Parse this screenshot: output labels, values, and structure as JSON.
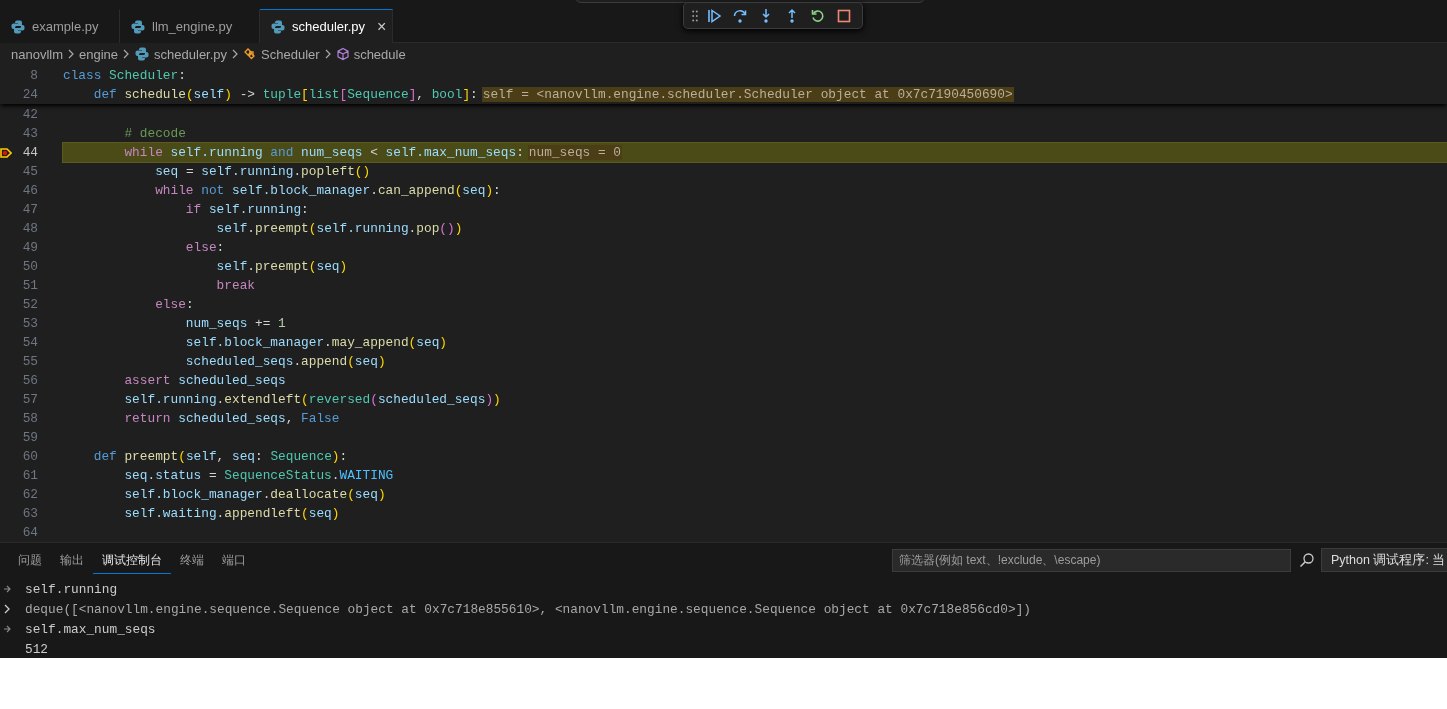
{
  "tabs": [
    {
      "label": "example.py",
      "selected": false
    },
    {
      "label": "llm_engine.py",
      "selected": false
    },
    {
      "label": "scheduler.py",
      "selected": true,
      "close": "×"
    }
  ],
  "debug_toolbar": [
    {
      "kind": "continue"
    },
    {
      "kind": "step-over"
    },
    {
      "kind": "step-into"
    },
    {
      "kind": "step-out"
    },
    {
      "kind": "restart"
    },
    {
      "kind": "stop"
    }
  ],
  "breadcrumbs": [
    {
      "label": "nanovllm",
      "kind": "folder"
    },
    {
      "label": "engine",
      "kind": "folder"
    },
    {
      "label": "scheduler.py",
      "kind": "file"
    },
    {
      "label": "Scheduler",
      "kind": "class"
    },
    {
      "label": "schedule",
      "kind": "method"
    }
  ],
  "sticky_lines": [
    {
      "number": "8",
      "tokens": [
        {
          "kind": "def",
          "text": "class "
        },
        {
          "kind": "cls",
          "text": "Scheduler"
        },
        {
          "kind": "p",
          "text": ":"
        }
      ]
    },
    {
      "number": "24",
      "tokens": [
        {
          "kind": "def",
          "text": "    def "
        },
        {
          "kind": "fn",
          "text": "schedule"
        },
        {
          "kind": "b1",
          "text": "("
        },
        {
          "kind": "var",
          "text": "self"
        },
        {
          "kind": "b1",
          "text": ")"
        },
        {
          "kind": "p",
          "text": " -> "
        },
        {
          "kind": "cls",
          "text": "tuple"
        },
        {
          "kind": "b1",
          "text": "["
        },
        {
          "kind": "cls",
          "text": "list"
        },
        {
          "kind": "b2",
          "text": "["
        },
        {
          "kind": "cls",
          "text": "Sequence"
        },
        {
          "kind": "b2",
          "text": "]"
        },
        {
          "kind": "p",
          "text": ", "
        },
        {
          "kind": "cls",
          "text": "bool"
        },
        {
          "kind": "b1",
          "text": "]"
        },
        {
          "kind": "p",
          "text": ":"
        }
      ],
      "inline_value": "self = <nanovllm.engine.scheduler.Scheduler object at 0x7c7190450690>"
    }
  ],
  "lines": [
    {
      "number": "42",
      "current": false
    },
    {
      "number": "43",
      "current": false,
      "tokens": [
        {
          "kind": "cmt",
          "text": "        # decode"
        }
      ]
    },
    {
      "number": "44",
      "current": true,
      "tokens": [
        {
          "kind": "kw",
          "text": "        while "
        },
        {
          "kind": "var",
          "text": "self.running "
        },
        {
          "kind": "def",
          "text": "and "
        },
        {
          "kind": "var",
          "text": "num_seqs"
        },
        {
          "kind": "p",
          "text": " < "
        },
        {
          "kind": "var",
          "text": "self.max_num_seqs"
        },
        {
          "kind": "p",
          "text": ":"
        }
      ],
      "inline_value": "num_seqs = 0"
    },
    {
      "number": "45",
      "current": false,
      "tokens": [
        {
          "kind": "var",
          "text": "            seq"
        },
        {
          "kind": "p",
          "text": " = "
        },
        {
          "kind": "var",
          "text": "self.running"
        },
        {
          "kind": "p",
          "text": "."
        },
        {
          "kind": "fn",
          "text": "popleft"
        },
        {
          "kind": "b1",
          "text": "()"
        }
      ]
    },
    {
      "number": "46",
      "current": false,
      "tokens": [
        {
          "kind": "kw",
          "text": "            while "
        },
        {
          "kind": "def",
          "text": "not "
        },
        {
          "kind": "var",
          "text": "self.block_manager"
        },
        {
          "kind": "p",
          "text": "."
        },
        {
          "kind": "fn",
          "text": "can_append"
        },
        {
          "kind": "b1",
          "text": "("
        },
        {
          "kind": "var",
          "text": "seq"
        },
        {
          "kind": "b1",
          "text": ")"
        },
        {
          "kind": "p",
          "text": ":"
        }
      ]
    },
    {
      "number": "47",
      "current": false,
      "tokens": [
        {
          "kind": "kw",
          "text": "                if "
        },
        {
          "kind": "var",
          "text": "self.running"
        },
        {
          "kind": "p",
          "text": ":"
        }
      ]
    },
    {
      "number": "48",
      "current": false,
      "tokens": [
        {
          "kind": "var",
          "text": "                    self"
        },
        {
          "kind": "p",
          "text": "."
        },
        {
          "kind": "fn",
          "text": "preempt"
        },
        {
          "kind": "b1",
          "text": "("
        },
        {
          "kind": "var",
          "text": "self.running"
        },
        {
          "kind": "p",
          "text": "."
        },
        {
          "kind": "fn",
          "text": "pop"
        },
        {
          "kind": "b2",
          "text": "()"
        },
        {
          "kind": "b1",
          "text": ")"
        }
      ]
    },
    {
      "number": "49",
      "current": false,
      "tokens": [
        {
          "kind": "kw",
          "text": "                else"
        },
        {
          "kind": "p",
          "text": ":"
        }
      ]
    },
    {
      "number": "50",
      "current": false,
      "tokens": [
        {
          "kind": "var",
          "text": "                    self"
        },
        {
          "kind": "p",
          "text": "."
        },
        {
          "kind": "fn",
          "text": "preempt"
        },
        {
          "kind": "b1",
          "text": "("
        },
        {
          "kind": "var",
          "text": "seq"
        },
        {
          "kind": "b1",
          "text": ")"
        }
      ]
    },
    {
      "number": "51",
      "current": false,
      "tokens": [
        {
          "kind": "kw",
          "text": "                    break"
        }
      ]
    },
    {
      "number": "52",
      "current": false,
      "tokens": [
        {
          "kind": "kw",
          "text": "            else"
        },
        {
          "kind": "p",
          "text": ":"
        }
      ]
    },
    {
      "number": "53",
      "current": false,
      "tokens": [
        {
          "kind": "var",
          "text": "                num_seqs"
        },
        {
          "kind": "p",
          "text": " += "
        },
        {
          "kind": "num",
          "text": "1"
        }
      ]
    },
    {
      "number": "54",
      "current": false,
      "tokens": [
        {
          "kind": "var",
          "text": "                self.block_manager"
        },
        {
          "kind": "p",
          "text": "."
        },
        {
          "kind": "fn",
          "text": "may_append"
        },
        {
          "kind": "b1",
          "text": "("
        },
        {
          "kind": "var",
          "text": "seq"
        },
        {
          "kind": "b1",
          "text": ")"
        }
      ]
    },
    {
      "number": "55",
      "current": false,
      "tokens": [
        {
          "kind": "var",
          "text": "                scheduled_seqs"
        },
        {
          "kind": "p",
          "text": "."
        },
        {
          "kind": "fn",
          "text": "append"
        },
        {
          "kind": "b1",
          "text": "("
        },
        {
          "kind": "var",
          "text": "seq"
        },
        {
          "kind": "b1",
          "text": ")"
        }
      ]
    },
    {
      "number": "56",
      "current": false,
      "tokens": [
        {
          "kind": "kw",
          "text": "        assert "
        },
        {
          "kind": "var",
          "text": "scheduled_seqs"
        }
      ]
    },
    {
      "number": "57",
      "current": false,
      "tokens": [
        {
          "kind": "var",
          "text": "        self.running"
        },
        {
          "kind": "p",
          "text": "."
        },
        {
          "kind": "fn",
          "text": "extendleft"
        },
        {
          "kind": "b1",
          "text": "("
        },
        {
          "kind": "cls",
          "text": "reversed"
        },
        {
          "kind": "b2",
          "text": "("
        },
        {
          "kind": "var",
          "text": "scheduled_seqs"
        },
        {
          "kind": "b2",
          "text": ")"
        },
        {
          "kind": "b1",
          "text": ")"
        }
      ]
    },
    {
      "number": "58",
      "current": false,
      "tokens": [
        {
          "kind": "kw",
          "text": "        return "
        },
        {
          "kind": "var",
          "text": "scheduled_seqs"
        },
        {
          "kind": "p",
          "text": ", "
        },
        {
          "kind": "def",
          "text": "False"
        }
      ]
    },
    {
      "number": "59",
      "current": false
    },
    {
      "number": "60",
      "current": false,
      "tokens": [
        {
          "kind": "def",
          "text": "    def "
        },
        {
          "kind": "fn",
          "text": "preempt"
        },
        {
          "kind": "b1",
          "text": "("
        },
        {
          "kind": "var",
          "text": "self"
        },
        {
          "kind": "p",
          "text": ", "
        },
        {
          "kind": "var",
          "text": "seq"
        },
        {
          "kind": "p",
          "text": ": "
        },
        {
          "kind": "cls",
          "text": "Sequence"
        },
        {
          "kind": "b1",
          "text": ")"
        },
        {
          "kind": "p",
          "text": ":"
        }
      ]
    },
    {
      "number": "61",
      "current": false,
      "tokens": [
        {
          "kind": "var",
          "text": "        seq.status"
        },
        {
          "kind": "p",
          "text": " = "
        },
        {
          "kind": "cls",
          "text": "SequenceStatus"
        },
        {
          "kind": "p",
          "text": "."
        },
        {
          "kind": "const",
          "text": "WAITING"
        }
      ]
    },
    {
      "number": "62",
      "current": false,
      "tokens": [
        {
          "kind": "var",
          "text": "        self.block_manager"
        },
        {
          "kind": "p",
          "text": "."
        },
        {
          "kind": "fn",
          "text": "deallocate"
        },
        {
          "kind": "b1",
          "text": "("
        },
        {
          "kind": "var",
          "text": "seq"
        },
        {
          "kind": "b1",
          "text": ")"
        }
      ]
    },
    {
      "number": "63",
      "current": false,
      "tokens": [
        {
          "kind": "var",
          "text": "        self.waiting"
        },
        {
          "kind": "p",
          "text": "."
        },
        {
          "kind": "fn",
          "text": "appendleft"
        },
        {
          "kind": "b1",
          "text": "("
        },
        {
          "kind": "var",
          "text": "seq"
        },
        {
          "kind": "b1",
          "text": ")"
        }
      ]
    },
    {
      "number": "64",
      "current": false
    }
  ],
  "panel": {
    "tabs": [
      {
        "label": "问题",
        "selected": false
      },
      {
        "label": "输出",
        "selected": false
      },
      {
        "label": "调试控制台",
        "selected": true
      },
      {
        "label": "终端",
        "selected": false
      },
      {
        "label": "端口",
        "selected": false
      }
    ],
    "filter": {
      "placeholder": "筛选器(例如 text、!exclude、\\escape)"
    },
    "session": "Python 调试程序: 当",
    "console": [
      {
        "kind": "input",
        "text": "self.running"
      },
      {
        "kind": "collapsed-result",
        "text": "deque([<nanovllm.engine.sequence.Sequence object at 0x7c718e855610>, <nanovllm.engine.sequence.Sequence object at 0x7c718e856cd0>])"
      },
      {
        "kind": "input",
        "text": "self.max_num_seqs"
      },
      {
        "kind": "result",
        "text": "512"
      }
    ]
  }
}
